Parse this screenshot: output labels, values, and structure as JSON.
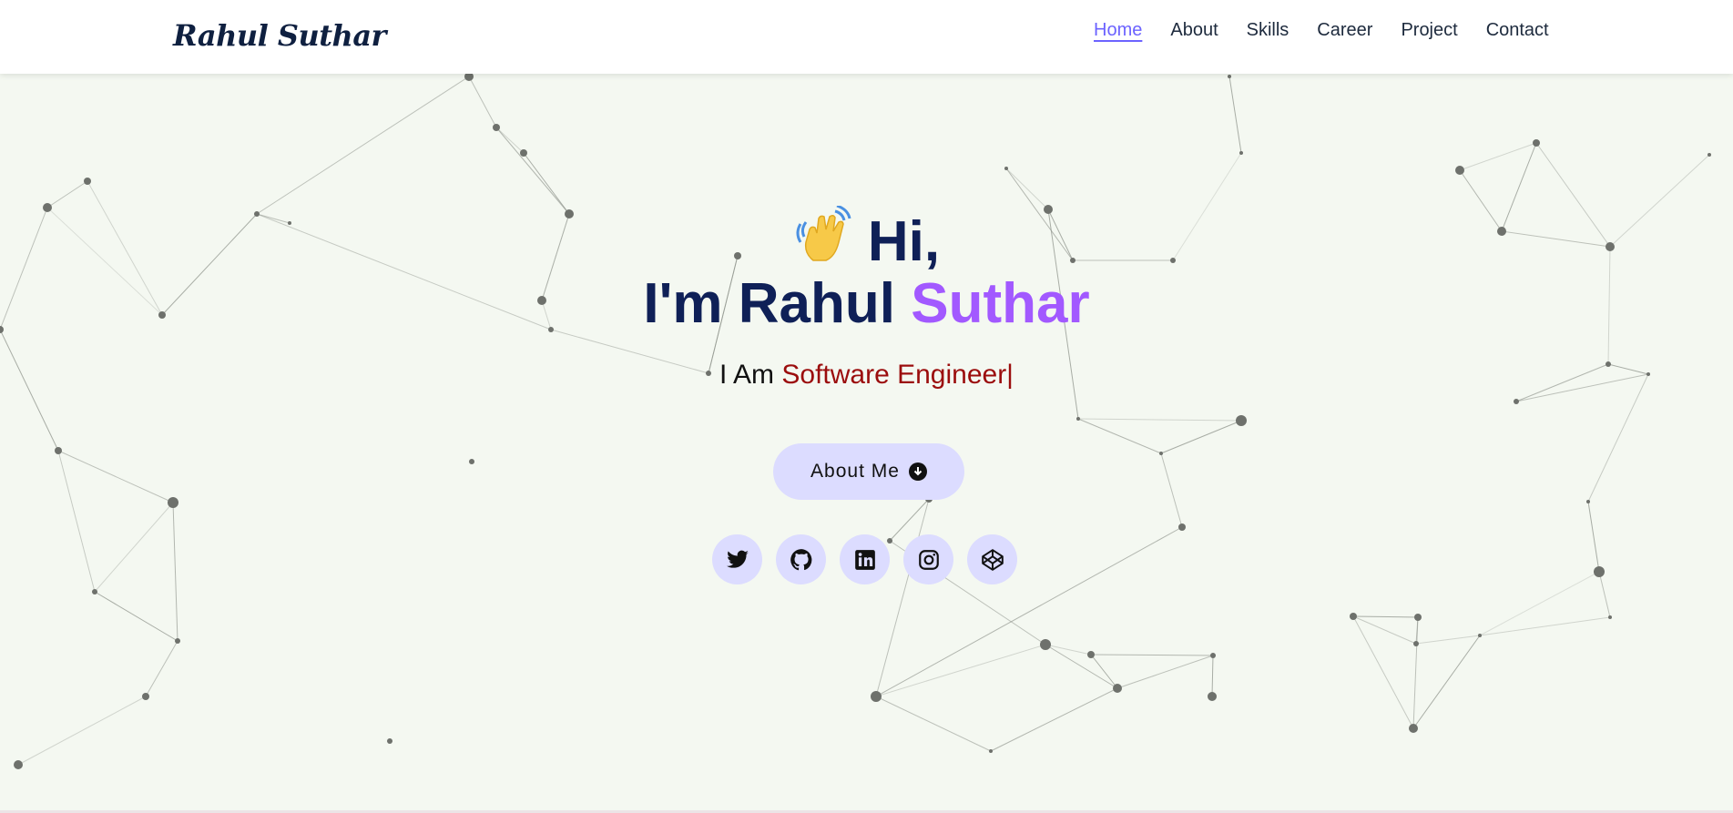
{
  "header": {
    "logo": "Rahul Suthar",
    "nav": [
      {
        "label": "Home",
        "active": true
      },
      {
        "label": "About",
        "active": false
      },
      {
        "label": "Skills",
        "active": false
      },
      {
        "label": "Career",
        "active": false
      },
      {
        "label": "Project",
        "active": false
      },
      {
        "label": "Contact",
        "active": false
      }
    ]
  },
  "hero": {
    "wave_icon": "waving-hand-icon",
    "greeting": "Hi,",
    "intro_prefix": "I'm Rahul",
    "intro_accent": "Suthar",
    "role_prefix": "I Am",
    "role_accent": "Software Engineer|",
    "cta_label": "About Me",
    "cta_icon": "arrow-down-circle-icon"
  },
  "socials": [
    {
      "icon": "twitter-icon"
    },
    {
      "icon": "github-icon"
    },
    {
      "icon": "linkedin-icon"
    },
    {
      "icon": "instagram-icon"
    },
    {
      "icon": "codepen-icon"
    }
  ],
  "colors": {
    "background": "#f4f8f1",
    "navy": "#0f2057",
    "accent_purple": "#a259ff",
    "role_red": "#9b0d0d",
    "nav_active": "#6c63ff",
    "pill_bg": "#dcdcff"
  }
}
